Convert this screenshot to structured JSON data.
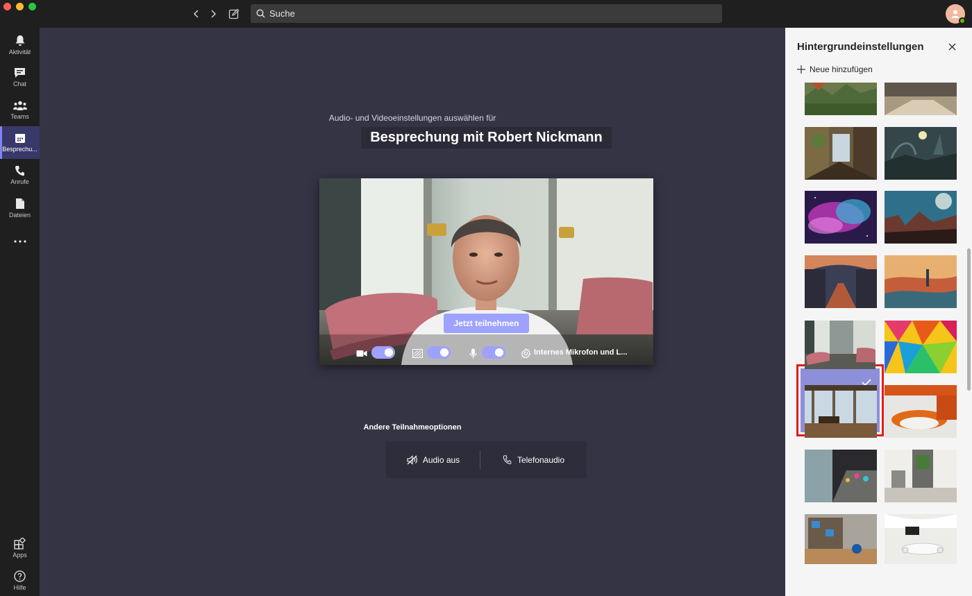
{
  "search": {
    "placeholder": "Suche"
  },
  "rail": {
    "items": [
      {
        "label": "Aktivität",
        "icon": "bell-icon"
      },
      {
        "label": "Chat",
        "icon": "chat-icon"
      },
      {
        "label": "Teams",
        "icon": "teams-icon"
      },
      {
        "label": "Besprechu...",
        "icon": "calendar-icon",
        "active": true
      },
      {
        "label": "Anrufe",
        "icon": "phone-icon"
      },
      {
        "label": "Dateien",
        "icon": "file-icon"
      }
    ],
    "more": "more-icon",
    "bottom": [
      {
        "label": "Apps",
        "icon": "apps-icon"
      },
      {
        "label": "Hilfe",
        "icon": "help-icon"
      }
    ]
  },
  "stage": {
    "subtitle": "Audio- und Videoeinstellungen auswählen für",
    "meeting_title": "Besprechung mit Robert Nickmann",
    "join_label": "Jetzt teilnehmen",
    "camera_on": true,
    "background_blur_on": true,
    "mic_on": true,
    "device_label": "Internes Mikrofon und L...",
    "other_title": "Andere Teilnahmeoptionen",
    "audio_off_label": "Audio aus",
    "phone_audio_label": "Telefonaudio"
  },
  "panel": {
    "title": "Hintergrundeinstellungen",
    "add_label": "Neue hinzufügen",
    "selected_index": 8,
    "thumbnails": [
      "mountain-valley",
      "desert-canyon",
      "fantasy-town",
      "sci-fi-landscape",
      "nebula",
      "alien-planet",
      "autumn-street",
      "sunset-fantasy",
      "office-lounge",
      "colorful-polygons",
      "office-cafe",
      "orange-meeting-pods",
      "office-corridor",
      "office-reception",
      "office-library",
      "white-meeting-room"
    ]
  },
  "colors": {
    "accent": "#9ea2ff",
    "rail_active": "#38386b",
    "stage_bg": "#353445",
    "selection_border": "#e11b1b"
  }
}
